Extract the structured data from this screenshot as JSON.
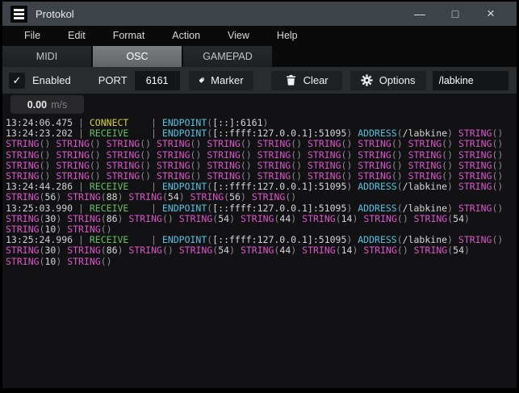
{
  "window": {
    "title": "Protokol",
    "controls": {
      "minimize": "—",
      "maximize": "□",
      "close": "×"
    }
  },
  "menu": {
    "items": [
      "File",
      "Edit",
      "Format",
      "Action",
      "View",
      "Help"
    ]
  },
  "tabs": [
    {
      "label": "MIDI",
      "active": false
    },
    {
      "label": "OSC",
      "active": true
    },
    {
      "label": "GAMEPAD",
      "active": false
    }
  ],
  "toolbar": {
    "enabled_checked": true,
    "check_glyph": "✓",
    "enabled_label": "Enabled",
    "port_label": "PORT",
    "port_value": "6161",
    "marker_label": "Marker",
    "clear_label": "Clear",
    "options_label": "Options",
    "address_value": "/labkine",
    "icons": {
      "marker": "tag-icon",
      "clear": "trash-icon",
      "options": "gear-icon"
    }
  },
  "speed": {
    "value": "0.00",
    "unit": "m/s"
  },
  "colors": {
    "titlebar": "#3d4349",
    "toolbar": "#2a2d2f",
    "log_background": "#121214",
    "timestamp": "#cfcfd4",
    "connect": "#d6d23e",
    "receive": "#63c163",
    "keyword": "#56c2e1",
    "string": "#d957c9",
    "paren": "#8b8b93",
    "value": "#d6d6da"
  },
  "log": {
    "lines": [
      [
        [
          "ts",
          "13:24:06.475"
        ],
        [
          "sp",
          " | "
        ],
        [
          "cn",
          "CONNECT"
        ],
        [
          "sp",
          "    | "
        ],
        [
          "kw",
          "ENDPOINT"
        ],
        [
          "p",
          "("
        ],
        [
          "v",
          "[::]:6161"
        ],
        [
          "p",
          ")"
        ]
      ],
      [
        [
          "ts",
          "13:24:23.202"
        ],
        [
          "sp",
          " | "
        ],
        [
          "rc",
          "RECEIVE"
        ],
        [
          "sp",
          "    | "
        ],
        [
          "kw",
          "ENDPOINT"
        ],
        [
          "p",
          "("
        ],
        [
          "v",
          "[::ffff:127.0.0.1]:51095"
        ],
        [
          "p",
          ") "
        ],
        [
          "kw",
          "ADDRESS"
        ],
        [
          "p",
          "("
        ],
        [
          "v",
          "/labkine"
        ],
        [
          "p",
          ") "
        ],
        [
          "str",
          "STRING"
        ],
        [
          "p",
          "()"
        ]
      ],
      [
        [
          "str",
          "STRING"
        ],
        [
          "p",
          "() "
        ],
        [
          "str",
          "STRING"
        ],
        [
          "p",
          "() "
        ],
        [
          "str",
          "STRING"
        ],
        [
          "p",
          "() "
        ],
        [
          "str",
          "STRING"
        ],
        [
          "p",
          "() "
        ],
        [
          "str",
          "STRING"
        ],
        [
          "p",
          "() "
        ],
        [
          "str",
          "STRING"
        ],
        [
          "p",
          "() "
        ],
        [
          "str",
          "STRING"
        ],
        [
          "p",
          "() "
        ],
        [
          "str",
          "STRING"
        ],
        [
          "p",
          "() "
        ],
        [
          "str",
          "STRING"
        ],
        [
          "p",
          "() "
        ],
        [
          "str",
          "STRING"
        ],
        [
          "p",
          "()"
        ]
      ],
      [
        [
          "str",
          "STRING"
        ],
        [
          "p",
          "() "
        ],
        [
          "str",
          "STRING"
        ],
        [
          "p",
          "() "
        ],
        [
          "str",
          "STRING"
        ],
        [
          "p",
          "() "
        ],
        [
          "str",
          "STRING"
        ],
        [
          "p",
          "() "
        ],
        [
          "str",
          "STRING"
        ],
        [
          "p",
          "() "
        ],
        [
          "str",
          "STRING"
        ],
        [
          "p",
          "() "
        ],
        [
          "str",
          "STRING"
        ],
        [
          "p",
          "() "
        ],
        [
          "str",
          "STRING"
        ],
        [
          "p",
          "() "
        ],
        [
          "str",
          "STRING"
        ],
        [
          "p",
          "() "
        ],
        [
          "str",
          "STRING"
        ],
        [
          "p",
          "()"
        ]
      ],
      [
        [
          "str",
          "STRING"
        ],
        [
          "p",
          "() "
        ],
        [
          "str",
          "STRING"
        ],
        [
          "p",
          "() "
        ],
        [
          "str",
          "STRING"
        ],
        [
          "p",
          "() "
        ],
        [
          "str",
          "STRING"
        ],
        [
          "p",
          "() "
        ],
        [
          "str",
          "STRING"
        ],
        [
          "p",
          "() "
        ],
        [
          "str",
          "STRING"
        ],
        [
          "p",
          "() "
        ],
        [
          "str",
          "STRING"
        ],
        [
          "p",
          "() "
        ],
        [
          "str",
          "STRING"
        ],
        [
          "p",
          "() "
        ],
        [
          "str",
          "STRING"
        ],
        [
          "p",
          "() "
        ],
        [
          "str",
          "STRING"
        ],
        [
          "p",
          "()"
        ]
      ],
      [
        [
          "str",
          "STRING"
        ],
        [
          "p",
          "() "
        ],
        [
          "str",
          "STRING"
        ],
        [
          "p",
          "() "
        ],
        [
          "str",
          "STRING"
        ],
        [
          "p",
          "() "
        ],
        [
          "str",
          "STRING"
        ],
        [
          "p",
          "() "
        ],
        [
          "str",
          "STRING"
        ],
        [
          "p",
          "() "
        ],
        [
          "str",
          "STRING"
        ],
        [
          "p",
          "() "
        ],
        [
          "str",
          "STRING"
        ],
        [
          "p",
          "() "
        ],
        [
          "str",
          "STRING"
        ],
        [
          "p",
          "() "
        ],
        [
          "str",
          "STRING"
        ],
        [
          "p",
          "() "
        ],
        [
          "str",
          "STRING"
        ],
        [
          "p",
          "()"
        ]
      ],
      [
        [
          "ts",
          "13:24:44.286"
        ],
        [
          "sp",
          " | "
        ],
        [
          "rc",
          "RECEIVE"
        ],
        [
          "sp",
          "    | "
        ],
        [
          "kw",
          "ENDPOINT"
        ],
        [
          "p",
          "("
        ],
        [
          "v",
          "[::ffff:127.0.0.1]:51095"
        ],
        [
          "p",
          ") "
        ],
        [
          "kw",
          "ADDRESS"
        ],
        [
          "p",
          "("
        ],
        [
          "v",
          "/labkine"
        ],
        [
          "p",
          ") "
        ],
        [
          "str",
          "STRING"
        ],
        [
          "p",
          "()"
        ]
      ],
      [
        [
          "str",
          "STRING"
        ],
        [
          "p",
          "("
        ],
        [
          "v",
          "56"
        ],
        [
          "p",
          ") "
        ],
        [
          "str",
          "STRING"
        ],
        [
          "p",
          "("
        ],
        [
          "v",
          "88"
        ],
        [
          "p",
          ") "
        ],
        [
          "str",
          "STRING"
        ],
        [
          "p",
          "("
        ],
        [
          "v",
          "54"
        ],
        [
          "p",
          ") "
        ],
        [
          "str",
          "STRING"
        ],
        [
          "p",
          "("
        ],
        [
          "v",
          "56"
        ],
        [
          "p",
          ") "
        ],
        [
          "str",
          "STRING"
        ],
        [
          "p",
          "()"
        ]
      ],
      [
        [
          "ts",
          "13:25:03.990"
        ],
        [
          "sp",
          " | "
        ],
        [
          "rc",
          "RECEIVE"
        ],
        [
          "sp",
          "    | "
        ],
        [
          "kw",
          "ENDPOINT"
        ],
        [
          "p",
          "("
        ],
        [
          "v",
          "[::ffff:127.0.0.1]:51095"
        ],
        [
          "p",
          ") "
        ],
        [
          "kw",
          "ADDRESS"
        ],
        [
          "p",
          "("
        ],
        [
          "v",
          "/labkine"
        ],
        [
          "p",
          ") "
        ],
        [
          "str",
          "STRING"
        ],
        [
          "p",
          "()"
        ]
      ],
      [
        [
          "str",
          "STRING"
        ],
        [
          "p",
          "("
        ],
        [
          "v",
          "30"
        ],
        [
          "p",
          ") "
        ],
        [
          "str",
          "STRING"
        ],
        [
          "p",
          "("
        ],
        [
          "v",
          "86"
        ],
        [
          "p",
          ") "
        ],
        [
          "str",
          "STRING"
        ],
        [
          "p",
          "() "
        ],
        [
          "str",
          "STRING"
        ],
        [
          "p",
          "("
        ],
        [
          "v",
          "54"
        ],
        [
          "p",
          ") "
        ],
        [
          "str",
          "STRING"
        ],
        [
          "p",
          "("
        ],
        [
          "v",
          "44"
        ],
        [
          "p",
          ") "
        ],
        [
          "str",
          "STRING"
        ],
        [
          "p",
          "("
        ],
        [
          "v",
          "14"
        ],
        [
          "p",
          ") "
        ],
        [
          "str",
          "STRING"
        ],
        [
          "p",
          "() "
        ],
        [
          "str",
          "STRING"
        ],
        [
          "p",
          "("
        ],
        [
          "v",
          "54"
        ],
        [
          "p",
          ")"
        ]
      ],
      [
        [
          "str",
          "STRING"
        ],
        [
          "p",
          "("
        ],
        [
          "v",
          "10"
        ],
        [
          "p",
          ") "
        ],
        [
          "str",
          "STRING"
        ],
        [
          "p",
          "()"
        ]
      ],
      [
        [
          "ts",
          "13:25:24.996"
        ],
        [
          "sp",
          " | "
        ],
        [
          "rc",
          "RECEIVE"
        ],
        [
          "sp",
          "    | "
        ],
        [
          "kw",
          "ENDPOINT"
        ],
        [
          "p",
          "("
        ],
        [
          "v",
          "[::ffff:127.0.0.1]:51095"
        ],
        [
          "p",
          ") "
        ],
        [
          "kw",
          "ADDRESS"
        ],
        [
          "p",
          "("
        ],
        [
          "v",
          "/labkine"
        ],
        [
          "p",
          ") "
        ],
        [
          "str",
          "STRING"
        ],
        [
          "p",
          "()"
        ]
      ],
      [
        [
          "str",
          "STRING"
        ],
        [
          "p",
          "("
        ],
        [
          "v",
          "30"
        ],
        [
          "p",
          ") "
        ],
        [
          "str",
          "STRING"
        ],
        [
          "p",
          "("
        ],
        [
          "v",
          "86"
        ],
        [
          "p",
          ") "
        ],
        [
          "str",
          "STRING"
        ],
        [
          "p",
          "() "
        ],
        [
          "str",
          "STRING"
        ],
        [
          "p",
          "("
        ],
        [
          "v",
          "54"
        ],
        [
          "p",
          ") "
        ],
        [
          "str",
          "STRING"
        ],
        [
          "p",
          "("
        ],
        [
          "v",
          "44"
        ],
        [
          "p",
          ") "
        ],
        [
          "str",
          "STRING"
        ],
        [
          "p",
          "("
        ],
        [
          "v",
          "14"
        ],
        [
          "p",
          ") "
        ],
        [
          "str",
          "STRING"
        ],
        [
          "p",
          "() "
        ],
        [
          "str",
          "STRING"
        ],
        [
          "p",
          "("
        ],
        [
          "v",
          "54"
        ],
        [
          "p",
          ")"
        ]
      ],
      [
        [
          "str",
          "STRING"
        ],
        [
          "p",
          "("
        ],
        [
          "v",
          "10"
        ],
        [
          "p",
          ") "
        ],
        [
          "str",
          "STRING"
        ],
        [
          "p",
          "()"
        ]
      ]
    ]
  }
}
